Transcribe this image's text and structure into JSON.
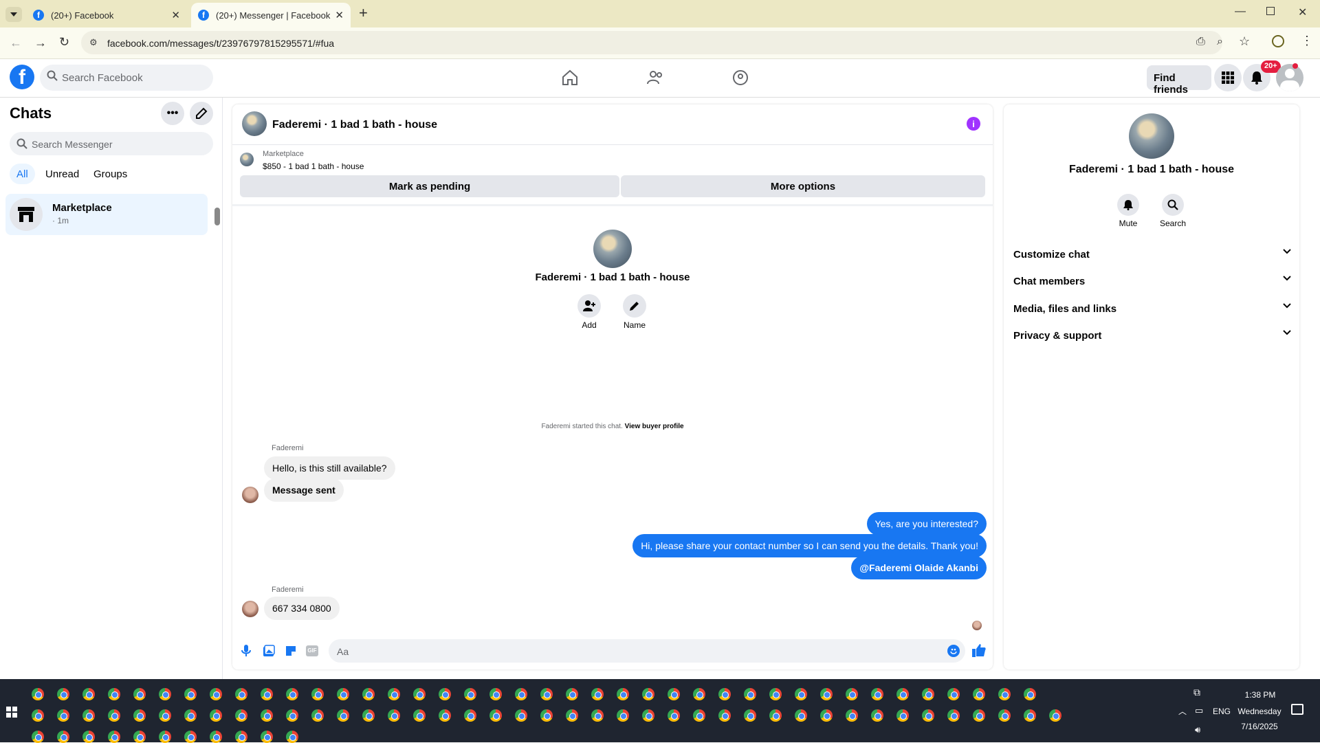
{
  "browser": {
    "tabs": [
      {
        "title": "(20+) Facebook"
      },
      {
        "title": "(20+) Messenger | Facebook"
      }
    ],
    "url": "facebook.com/messages/t/23976797815295571/#fua"
  },
  "fb_header": {
    "logo": "f",
    "search_placeholder": "Search Facebook",
    "find_friends": "Find friends",
    "notifications_badge": "20+"
  },
  "chats": {
    "title": "Chats",
    "search_placeholder": "Search Messenger",
    "filters": [
      "All",
      "Unread",
      "Groups"
    ],
    "items": [
      {
        "name": "Marketplace",
        "time": "· 1m"
      }
    ]
  },
  "conversation": {
    "title": "Faderemi · 1 bad 1 bath - house",
    "marketplace_label": "Marketplace",
    "listing": "$850 - 1 bad 1 bath - house",
    "mark_pending": "Mark as pending",
    "more_options": "More options",
    "intro_name": "Faderemi · 1 bad 1 bath - house",
    "add_label": "Add",
    "name_label": "Name",
    "started_text": "Faderemi started this chat.",
    "view_profile": "View buyer profile",
    "sender_name": "Faderemi",
    "messages_in_1": [
      "Hello, is this still available?",
      "Message sent"
    ],
    "messages_out": [
      "Yes, are you interested?",
      "Hi, please share your contact number so I can send you the details. Thank you!",
      "@Faderemi Olaide Akanbi"
    ],
    "messages_in_2": [
      "667 334 0800"
    ],
    "composer_placeholder": "Aa"
  },
  "details": {
    "name": "Faderemi · 1 bad 1 bath - house",
    "mute": "Mute",
    "search": "Search",
    "sections": [
      "Customize chat",
      "Chat members",
      "Media, files and links",
      "Privacy & support"
    ]
  },
  "taskbar": {
    "time": "1:38 PM",
    "day": "Wednesday",
    "date": "7/16/2025",
    "lang": "ENG"
  },
  "colors": {
    "accent": "#1877f2",
    "badge": "#e41e3f",
    "info": "#a033ff"
  }
}
